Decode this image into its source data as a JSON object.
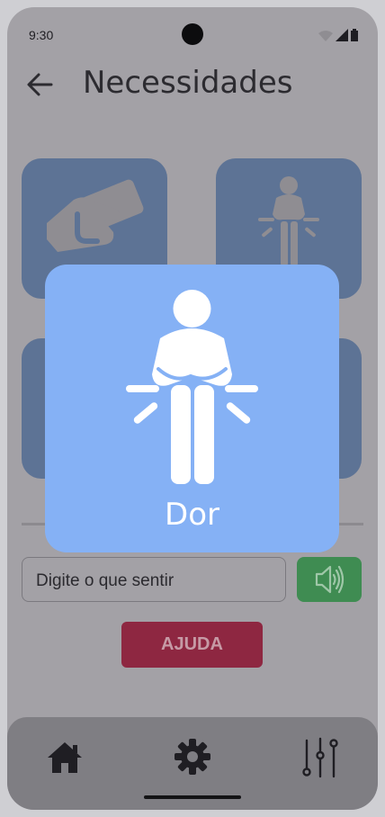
{
  "status_bar": {
    "time": "9:30"
  },
  "app_bar": {
    "title": "Necessidades"
  },
  "tiles": [
    {
      "icon": "payment-hand-icon"
    },
    {
      "icon": "pain-person-icon"
    },
    {
      "icon": "unknown-icon"
    },
    {
      "icon": "unknown-icon"
    }
  ],
  "modal": {
    "label": "Dor",
    "icon": "pain-person-icon",
    "background": "#85b1f5"
  },
  "input": {
    "placeholder": "Digite o que sentir"
  },
  "speak_button": {
    "icon": "speaker-icon",
    "color": "#3f8c52"
  },
  "help_button": {
    "label": "AJUDA",
    "color": "#8e2741"
  },
  "bottom_nav": {
    "items": [
      "home-icon",
      "gear-icon",
      "sliders-icon"
    ]
  }
}
